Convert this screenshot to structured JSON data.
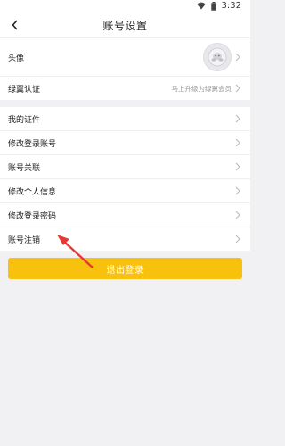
{
  "status_bar": {
    "time": "3:32",
    "icons": [
      "wifi-icon",
      "battery-icon"
    ]
  },
  "header": {
    "title": "账号设置",
    "back_icon": "chevron-left-icon"
  },
  "profile_group": {
    "avatar_label": "头像",
    "member_label": "绿翼认证",
    "member_value": "马上升级为绿翼会员"
  },
  "settings_list": {
    "items": [
      {
        "label": "我的证件"
      },
      {
        "label": "修改登录账号"
      },
      {
        "label": "账号关联"
      },
      {
        "label": "修改个人信息"
      },
      {
        "label": "修改登录密码"
      },
      {
        "label": "账号注销"
      }
    ]
  },
  "logout": {
    "label": "退出登录"
  },
  "colors": {
    "accent": "#f8c10e",
    "annotation": "#e53935",
    "background": "#f1f1f4"
  }
}
